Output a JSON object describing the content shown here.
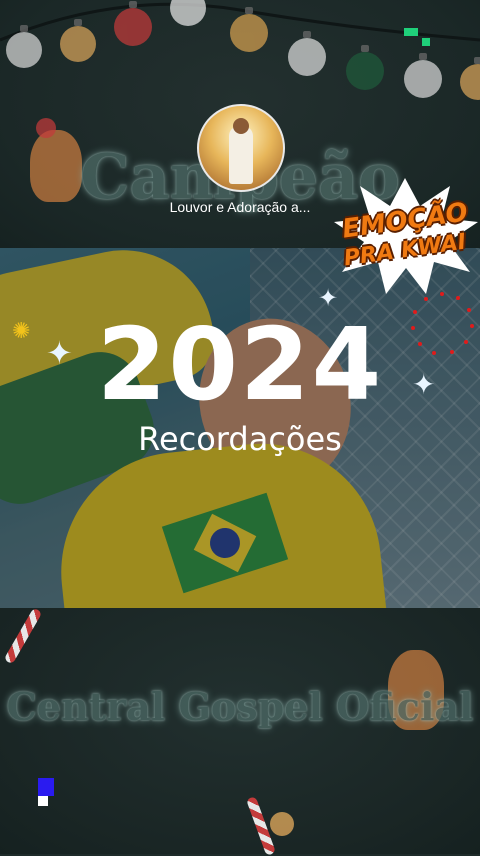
{
  "video": {
    "bg_title_top": "Campeão",
    "bg_title_bottom": "Central Gospel Oficial",
    "year": "2024",
    "subtitle": "Recordações"
  },
  "channel": {
    "name": "Louvor e Adoração a..."
  },
  "badge": {
    "line1": "EMOÇÃO",
    "line2": "PRA KWAI"
  },
  "colors": {
    "background": "#1e2b2a",
    "badge_orange": "#f07a12",
    "accent_green": "#1fd07a",
    "accent_blue": "#2a1bf0"
  }
}
